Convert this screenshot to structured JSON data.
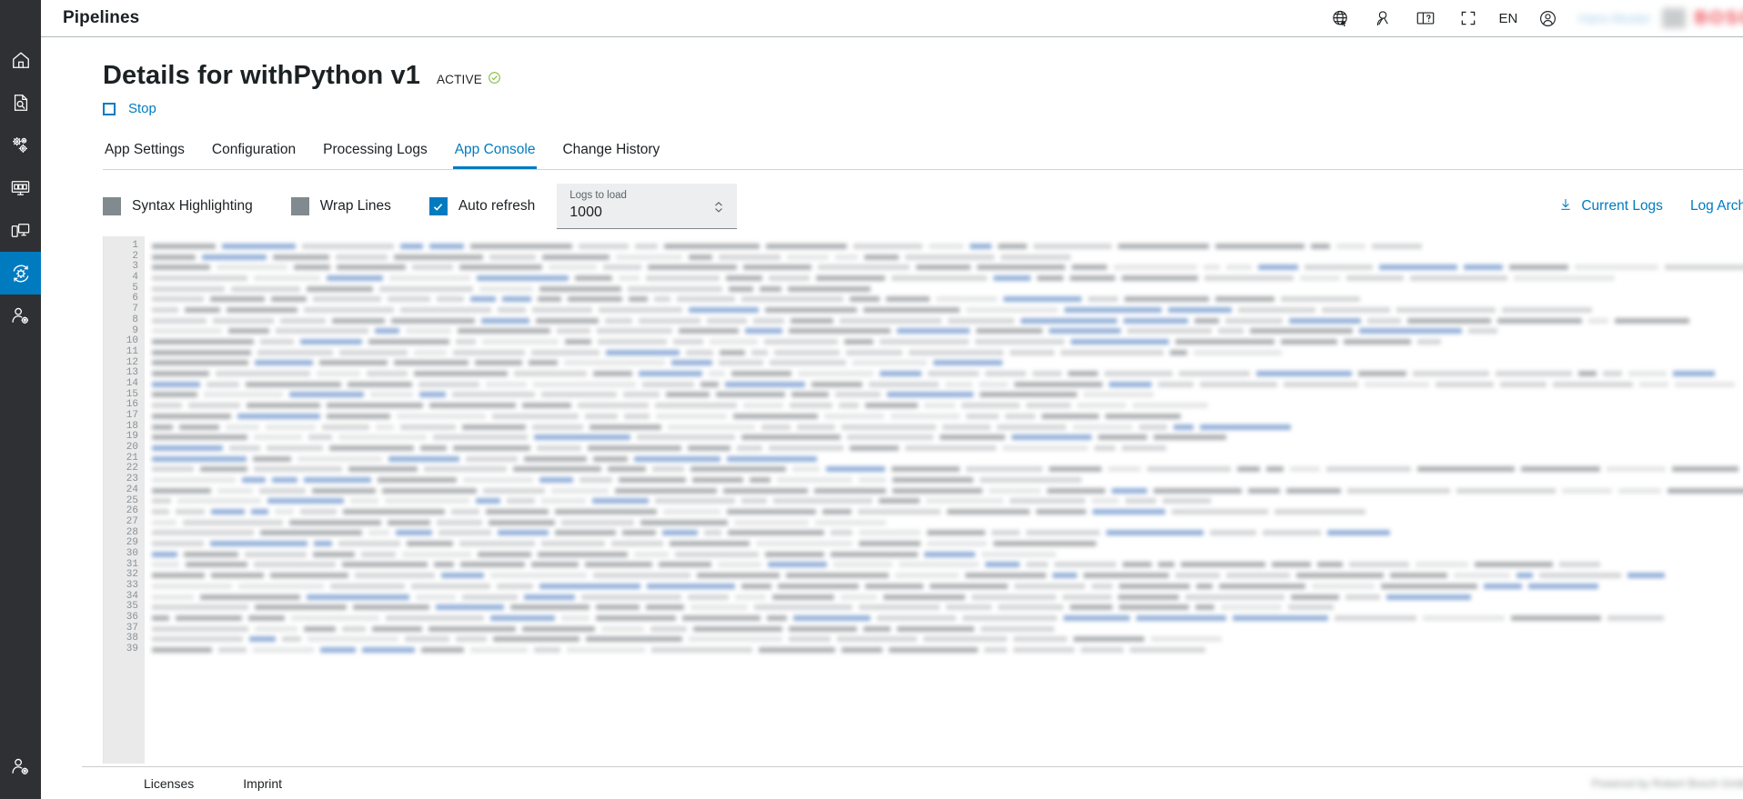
{
  "sidebar": {
    "items": [
      {
        "name": "home",
        "icon": "home-icon",
        "active": false
      },
      {
        "name": "device-search",
        "icon": "document-search-icon",
        "active": false
      },
      {
        "name": "settings",
        "icon": "gears-icon",
        "active": false
      },
      {
        "name": "dashboard",
        "icon": "monitor-dashboard-icon",
        "active": false
      },
      {
        "name": "devices",
        "icon": "devices-icon",
        "active": false
      },
      {
        "name": "pipelines",
        "icon": "gear-refresh-icon",
        "active": true
      },
      {
        "name": "user-management",
        "icon": "person-settings-icon",
        "active": false
      }
    ],
    "bottom_item": {
      "name": "account-settings",
      "icon": "person-settings-icon"
    }
  },
  "header": {
    "title": "Pipelines",
    "icons": [
      "globe-pointer-icon",
      "person-search-icon",
      "book-help-icon",
      "fullscreen-icon"
    ],
    "language": "EN",
    "account_icon": "account-circle-icon",
    "user_name": "Hans Muster",
    "logo_text": "BOSCH",
    "logo_color": "#ed4a52",
    "user_name_color": "#9dc8e8"
  },
  "page": {
    "title": "Details for withPython v1",
    "status": "ACTIVE",
    "status_icon": "check-circle-icon",
    "status_color": "#84c043",
    "stop_label": "Stop",
    "stop_icon": "stop-square-icon",
    "accent_color": "#007bc0"
  },
  "tabs": [
    {
      "label": "App Settings",
      "active": false
    },
    {
      "label": "Configuration",
      "active": false
    },
    {
      "label": "Processing Logs",
      "active": false
    },
    {
      "label": "App Console",
      "active": true
    },
    {
      "label": "Change History",
      "active": false
    }
  ],
  "toolbar": {
    "checkboxes": [
      {
        "label": "Syntax Highlighting",
        "checked": false,
        "state_color": "#808a8f"
      },
      {
        "label": "Wrap Lines",
        "checked": false,
        "state_color": "#808a8f"
      },
      {
        "label": "Auto refresh",
        "checked": true,
        "state_color": "#007bc0"
      }
    ],
    "logs_to_load": {
      "label": "Logs to load",
      "value": "1000",
      "spinner_icon": "spinner-updown-icon"
    },
    "download_icon": "download-arrow-icon",
    "current_logs_label": "Current Logs",
    "log_archive_label": "Log Archive"
  },
  "console": {
    "first_line": 1,
    "last_line": 39,
    "line_numbers": [
      "1",
      "2",
      "3",
      "4",
      "5",
      "6",
      "7",
      "8",
      "9",
      "10",
      "11",
      "12",
      "13",
      "14",
      "15",
      "16",
      "17",
      "18",
      "19",
      "20",
      "21",
      "22",
      "23",
      "24",
      "25",
      "26",
      "27",
      "28",
      "29",
      "30",
      "31",
      "32",
      "33",
      "34",
      "35",
      "36",
      "37",
      "38",
      "39"
    ],
    "content_state": "blurred-redacted",
    "gutter_bg": "#eaeaea",
    "gutter_text_color": "#8a9094"
  },
  "footer": {
    "licenses_label": "Licenses",
    "imprint_label": "Imprint",
    "powered_by": "Powered by Robert Bosch GmbH"
  }
}
